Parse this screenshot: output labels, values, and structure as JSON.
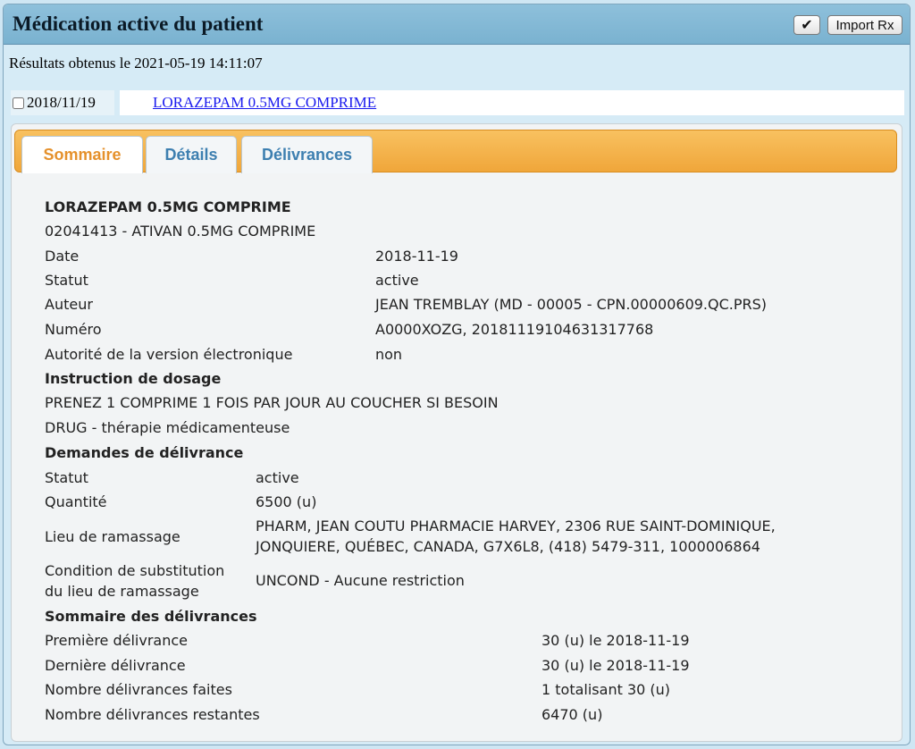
{
  "header": {
    "title": "Médication active du patient",
    "check_label": "✔",
    "import_label": "Import Rx"
  },
  "results_text": "Résultats obtenus le 2021-05-19 14:11:07",
  "medication_row": {
    "date": "2018/11/19",
    "link": "LORAZEPAM 0.5MG COMPRIME"
  },
  "tabs": [
    {
      "label": "Sommaire",
      "active": true
    },
    {
      "label": "Détails",
      "active": false
    },
    {
      "label": "Délivrances",
      "active": false
    }
  ],
  "summary": {
    "drug_name": "LORAZEPAM 0.5MG COMPRIME",
    "drug_code": "02041413 - ATIVAN 0.5MG COMPRIME",
    "fields": [
      {
        "label": "Date",
        "value": "2018-11-19"
      },
      {
        "label": "Statut",
        "value": "active"
      },
      {
        "label": "Auteur",
        "value": "JEAN TREMBLAY (MD - 00005 - CPN.00000609.QC.PRS)"
      },
      {
        "label": "Numéro",
        "value": "A0000XOZG, 20181119104631317768"
      },
      {
        "label": "Autorité de la version électronique",
        "value": "non"
      }
    ],
    "dosage_heading": "Instruction de dosage",
    "dosage_text": "PRENEZ 1 COMPRIME 1 FOIS PAR JOUR AU COUCHER SI BESOIN",
    "therapy_text": "DRUG - thérapie médicamenteuse",
    "requests_heading": "Demandes de délivrance",
    "requests": {
      "statut_label": "Statut",
      "statut_value": "active",
      "quantite_label": "Quantité",
      "quantite_value": "6500 (u)",
      "lieu_label": "Lieu de ramassage",
      "lieu_line1": "PHARM, JEAN COUTU PHARMACIE HARVEY, 2306 RUE SAINT-DOMINIQUE,",
      "lieu_line2": "JONQUIERE, QUÉBEC, CANADA, G7X6L8, (418) 5479-311, 1000006864",
      "condition_line1": "Condition de substitution",
      "condition_line2": "du lieu de ramassage",
      "condition_value": "UNCOND - Aucune restriction"
    },
    "deliveries_heading": "Sommaire des délivrances",
    "deliveries": [
      {
        "label": "Première délivrance",
        "value": "30 (u) le 2018-11-19"
      },
      {
        "label": "Dernière délivrance",
        "value": "30 (u) le 2018-11-19"
      },
      {
        "label": "Nombre délivrances faites",
        "value": "1 totalisant 30 (u)"
      },
      {
        "label": "Nombre délivrances restantes",
        "value": "6470 (u)"
      }
    ]
  }
}
